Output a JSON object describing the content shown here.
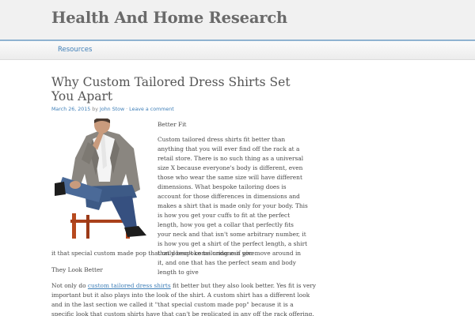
{
  "site": {
    "title": "Health And Home Research"
  },
  "nav": {
    "items": [
      {
        "label": "Resources"
      }
    ]
  },
  "post": {
    "title": "Why Custom Tailored Dress Shirts Set You Apart",
    "meta": {
      "date": "March 26, 2015",
      "by": " by ",
      "author": "John Stow",
      "separator": " · ",
      "comment_link": "Leave a comment"
    },
    "sections": [
      {
        "heading": "Better Fit",
        "body_wrapped": "Custom tailored dress shirts fit better than anything that you will ever find off the rack at a retail store. There is no such thing as a universal size X because everyone's body is different, even those who wear the same size will have different dimensions. What bespoke tailoring does is account for those differences in dimensions and makes a shirt that is made only for your body. This is how you get your cuffs to fit at the perfect length, how you get a collar that perfectly fits your neck and that isn't some arbitrary number, it is how you get a shirt of the perfect length, a shirt that doesn't come undone if you move around in it, and one that has the perfect seam and body length to give",
        "body_tail": "it that special custom made pop that only bespoke tailoring can give."
      },
      {
        "heading": "They Look Better",
        "body_before_link": "Not only do ",
        "link_text": "custom tailored dress shirts",
        "body_after_link": " fit better but they also look better. Yes fit is very important but it also plays into the look of the shirt. A custom shirt has a different look and in the last section we called it \"that special custom made pop\" because it is a specific look that custom shirts have that can't be replicated in any off the rack offering."
      }
    ]
  },
  "photo": {
    "icon": "man-in-suit-photo"
  }
}
